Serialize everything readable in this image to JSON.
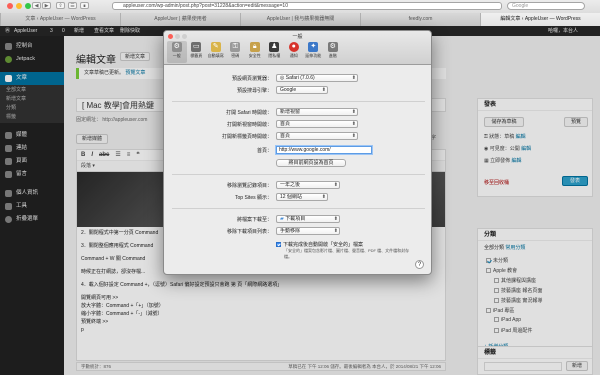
{
  "browser": {
    "url": "appleuser.com/wp-admin/post.php?post=31228&action=edit&message=10",
    "search_placeholder": "Google",
    "tabs": [
      "文章 ‹ AppleUser — WordPress",
      "AppleUser | 蘋果使用者",
      "AppleUser | 我与蘋果機器無關",
      "feedly.com",
      "編輯文章 ‹ AppleUser — WordPress"
    ],
    "active_tab": 4
  },
  "admin_bar": {
    "site": "AppleUser",
    "count": "3",
    "comments": "0",
    "new": "新增",
    "view": "查看文章",
    "purge": "刪除快取",
    "user": "哈囉，本台人"
  },
  "sidebar": {
    "items": [
      "控制台",
      "Jetpack",
      "文章",
      "媒體",
      "連結",
      "頁面",
      "留言",
      "個人資訊",
      "工具",
      "折疊選單"
    ],
    "sub": [
      "全部文章",
      "新增文章",
      "分類",
      "標籤"
    ]
  },
  "editor": {
    "page_title": "編輯文章",
    "add_new": "新增文章",
    "notice": "文章草稿已更新。",
    "notice_link": "預覽文章",
    "post_title": "[ Mac 教學]會用熱鍵",
    "permalink": "固定網址： http://appleuser.com",
    "add_media": "新增媒體",
    "tab_visual": "視覺",
    "tab_text": "文字",
    "format": "段落",
    "body": [
      "2．關閉程式中第一分頁 Command",
      "3．關閉整個應用程式 Command",
      "Command + W 關 Command",
      "時候正在打網誌，卻沒存檔...",
      "4．載入個好設定 Command +，（逗號）Safari 偏好設定預設只會跑 第 頁「網際網路選項」",
      "開覽網頁可用 >>",
      "放大字體：Command +「+」（加號）",
      "縮小字體：Command +「-」（減號）",
      "預覽終端 >>",
      "p"
    ],
    "word_count": "字數統計：876",
    "last_edit": "草稿已在 下午 12:06 儲存。最後編輯者為 本台人，於 2014/08/21 下午 12:06"
  },
  "publish": {
    "title": "發表",
    "save_draft": "儲存為草稿",
    "preview": "預覽",
    "status": "狀態：草稿",
    "status_edit": "編輯",
    "visibility": "可見度：公開",
    "visibility_edit": "編輯",
    "schedule": "立即發佈",
    "schedule_edit": "編輯",
    "trash": "移至回收桶",
    "publish": "發表"
  },
  "categories": {
    "title": "分類",
    "tab_all": "全部分類",
    "tab_popular": "常用分類",
    "items": [
      "未分類",
      "Apple 教會",
      "其他課程與講座",
      "技藝講座 報名頁面",
      "技藝講座 實況報導",
      "iPad 專區",
      "iPad App",
      "iPad 周邊配件"
    ],
    "add": "+ 新增分類"
  },
  "tags": {
    "title": "標籤",
    "add": "新增"
  },
  "prefs": {
    "title": "一般",
    "toolbar": [
      "一般",
      "標籤頁",
      "自動填寫",
      "密碼",
      "安全性",
      "隱私權",
      "通知",
      "延伸功能",
      "進階"
    ],
    "rows": {
      "default_browser_label": "預設網頁瀏覽器：",
      "default_browser": "Safari (7.0.6)",
      "search_label": "預設搜尋引擎：",
      "search": "Google",
      "new_window_label": "打開 Safari 時開啟：",
      "new_window": "新增視窗",
      "new_window_open_label": "打開新視窗時開啟：",
      "new_window_open": "首頁",
      "new_tab_label": "打開新標籤頁時開啟：",
      "new_tab": "首頁",
      "homepage_label": "首頁：",
      "homepage": "http://www.google.com/",
      "set_current": "將目前網頁設為首頁",
      "history_label": "移除瀏覽記錄項目：",
      "history": "一年之後",
      "topsites_label": "Top Sites 顯示：",
      "topsites": "12 個網站",
      "download_label": "將檔案下載至：",
      "download": "下載項目",
      "remove_dl_label": "移除下載項目列表：",
      "remove_dl": "手動移除",
      "safe_files": "下載完成後自動開啟「安全的」檔案",
      "safe_note": "「安全的」檔案包含影片檔、圖片檔、聲音檔、PDF 檔、文件檔和封存檔。"
    }
  }
}
